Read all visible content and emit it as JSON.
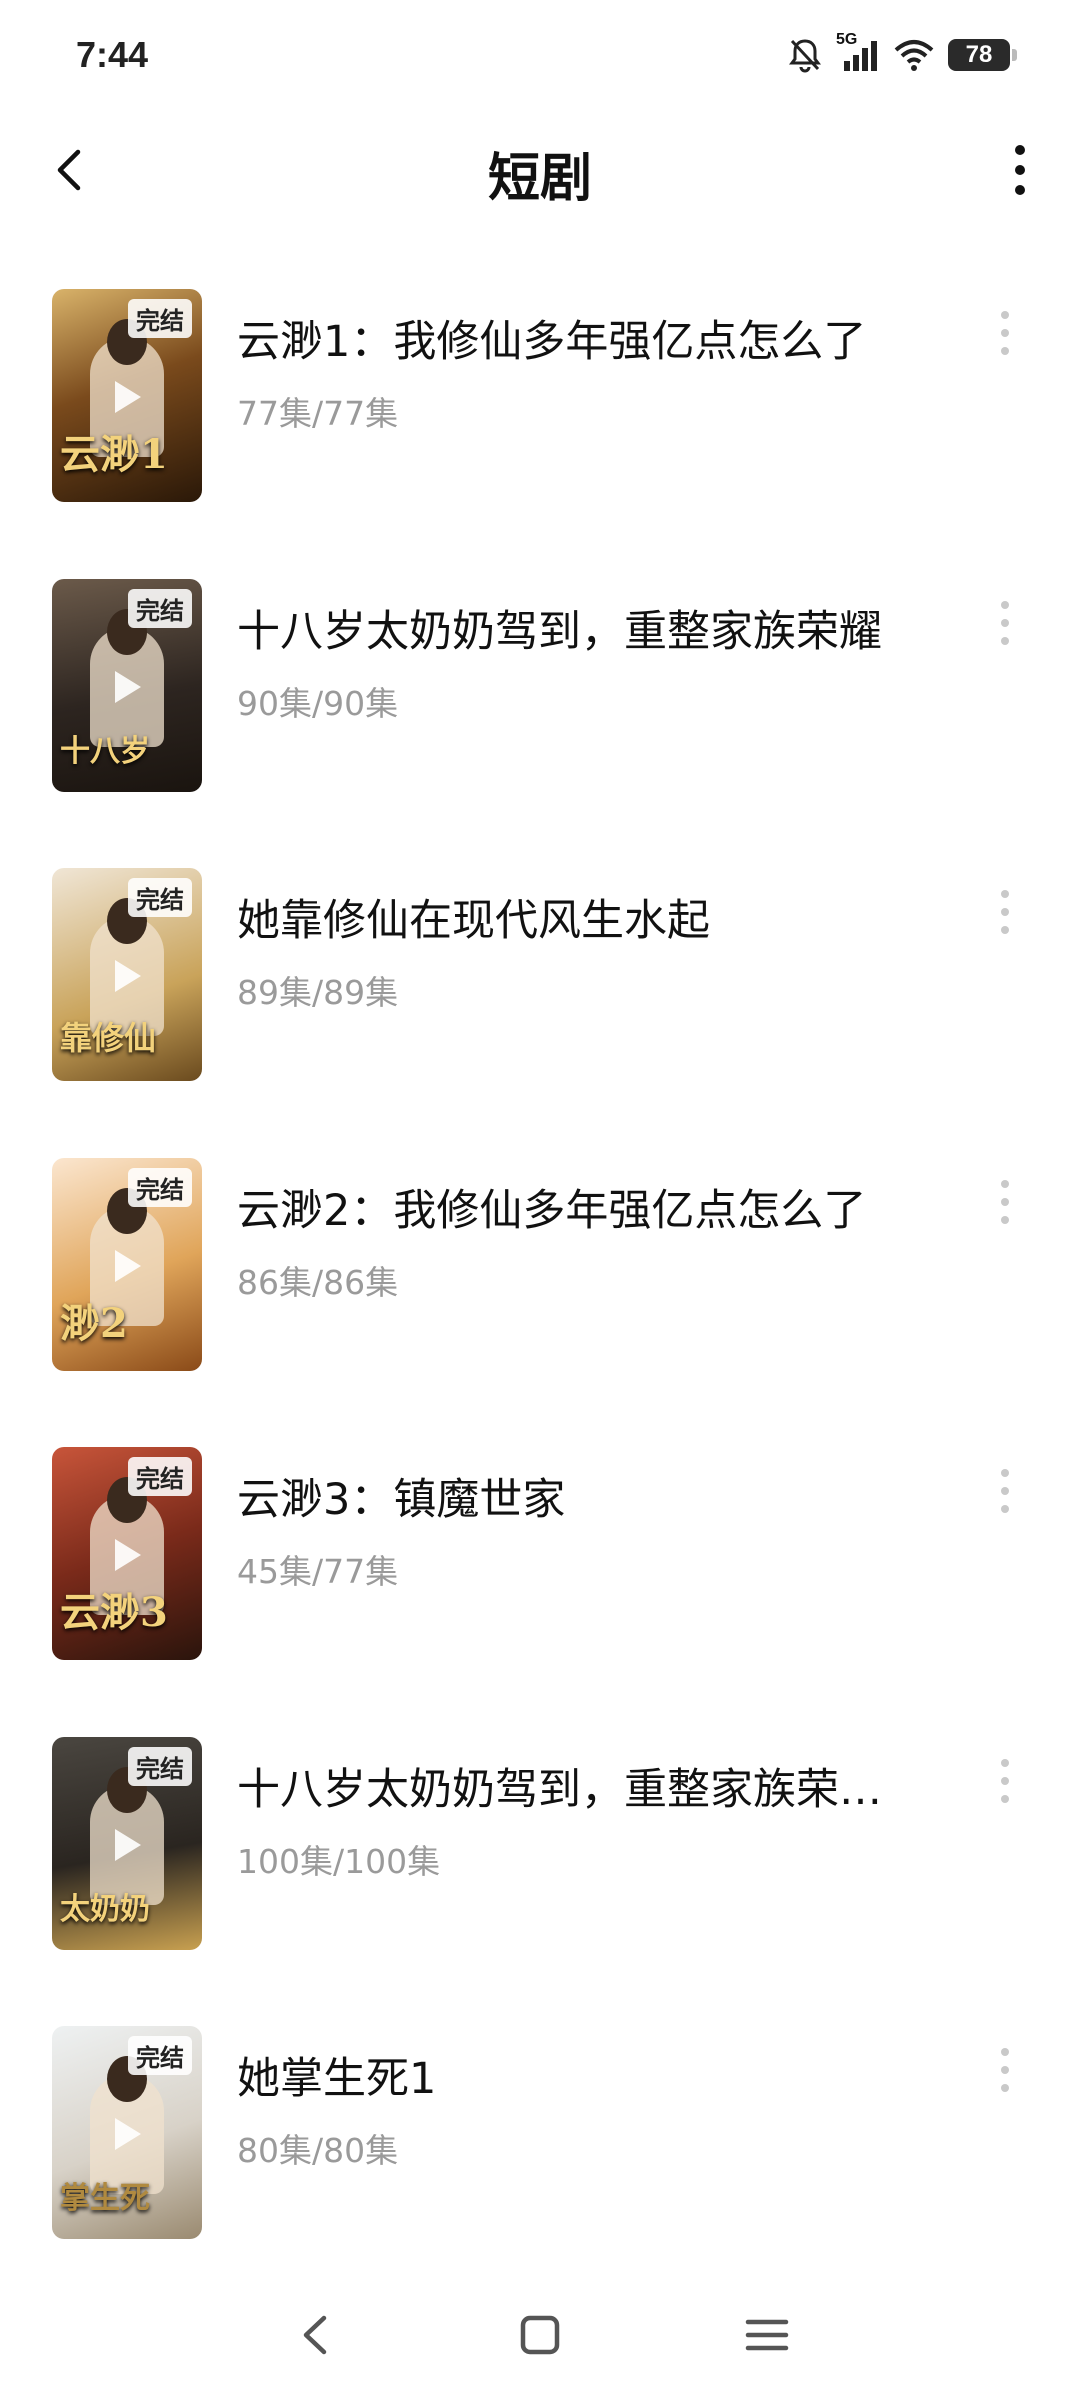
{
  "status_bar": {
    "time": "7:44",
    "network": "5G",
    "battery": "78"
  },
  "header": {
    "title": "短剧"
  },
  "items": [
    {
      "title": "云渺1：我修仙多年强亿点怎么了",
      "count": "77集/77集",
      "badge": "完结",
      "art": "云渺1"
    },
    {
      "title": "十八岁太奶奶驾到，重整家族荣耀",
      "count": "90集/90集",
      "badge": "完结",
      "art": "十八岁"
    },
    {
      "title": "她靠修仙在现代风生水起",
      "count": "89集/89集",
      "badge": "完结",
      "art": "靠修仙"
    },
    {
      "title": "云渺2：我修仙多年强亿点怎么了",
      "count": "86集/86集",
      "badge": "完结",
      "art": "渺2"
    },
    {
      "title": "云渺3：镇魔世家",
      "count": "45集/77集",
      "badge": "完结",
      "art": "云渺3"
    },
    {
      "title": "十八岁太奶奶驾到，重整家族荣…",
      "count": "100集/100集",
      "badge": "完结",
      "art": "太奶奶"
    },
    {
      "title": "她掌生死1",
      "count": "80集/80集",
      "badge": "完结",
      "art": "掌生死"
    }
  ]
}
